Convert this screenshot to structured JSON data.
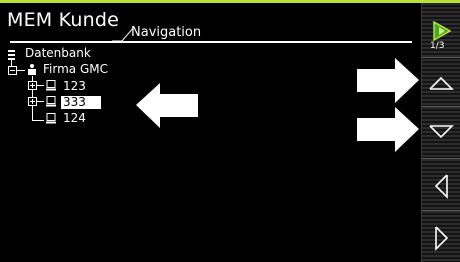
{
  "header": {
    "title": "MEM Kunde",
    "subtitle": "Navigation",
    "accent_color": "#b8e23a"
  },
  "sidebar": {
    "page_indicator": "1/3",
    "buttons": [
      {
        "name": "play-next-icon"
      },
      {
        "name": "arrow-up-icon"
      },
      {
        "name": "arrow-down-icon"
      },
      {
        "name": "arrow-left-icon"
      },
      {
        "name": "arrow-right-icon"
      }
    ]
  },
  "tree": {
    "root": "Datenbank",
    "customer": "Firma GMC",
    "items": [
      "123",
      "333",
      "124"
    ],
    "selected": "333"
  }
}
